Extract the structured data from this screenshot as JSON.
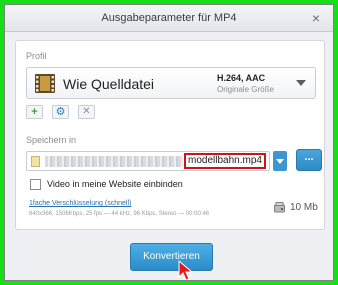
{
  "window": {
    "title": "Ausgabeparameter für MP4"
  },
  "profile": {
    "section_label": "Profil",
    "name": "Wie Quelldatei",
    "codec": "H.264, AAC",
    "size_note": "Originale Größe",
    "buttons": {
      "add": "+",
      "settings": "⚙",
      "remove": "✕"
    }
  },
  "save": {
    "section_label": "Speichern in",
    "filename": "modellbahn.mp4",
    "browse_label": "..."
  },
  "website_checkbox": {
    "label": "Video in meine Website einbinden",
    "checked": false
  },
  "encoding": {
    "title": "1fache Verschlüsselung (schnell)",
    "details": "640x366, 1506Kbps, 25 fps — 44 kHz, 96 Kbps, Stereo — 00:00:46"
  },
  "estimated_size": "10 Mb",
  "convert_button": "Konvertieren",
  "colors": {
    "accent": "#2f89c4",
    "highlight_border": "#d0121b",
    "frame": "#14e014"
  }
}
